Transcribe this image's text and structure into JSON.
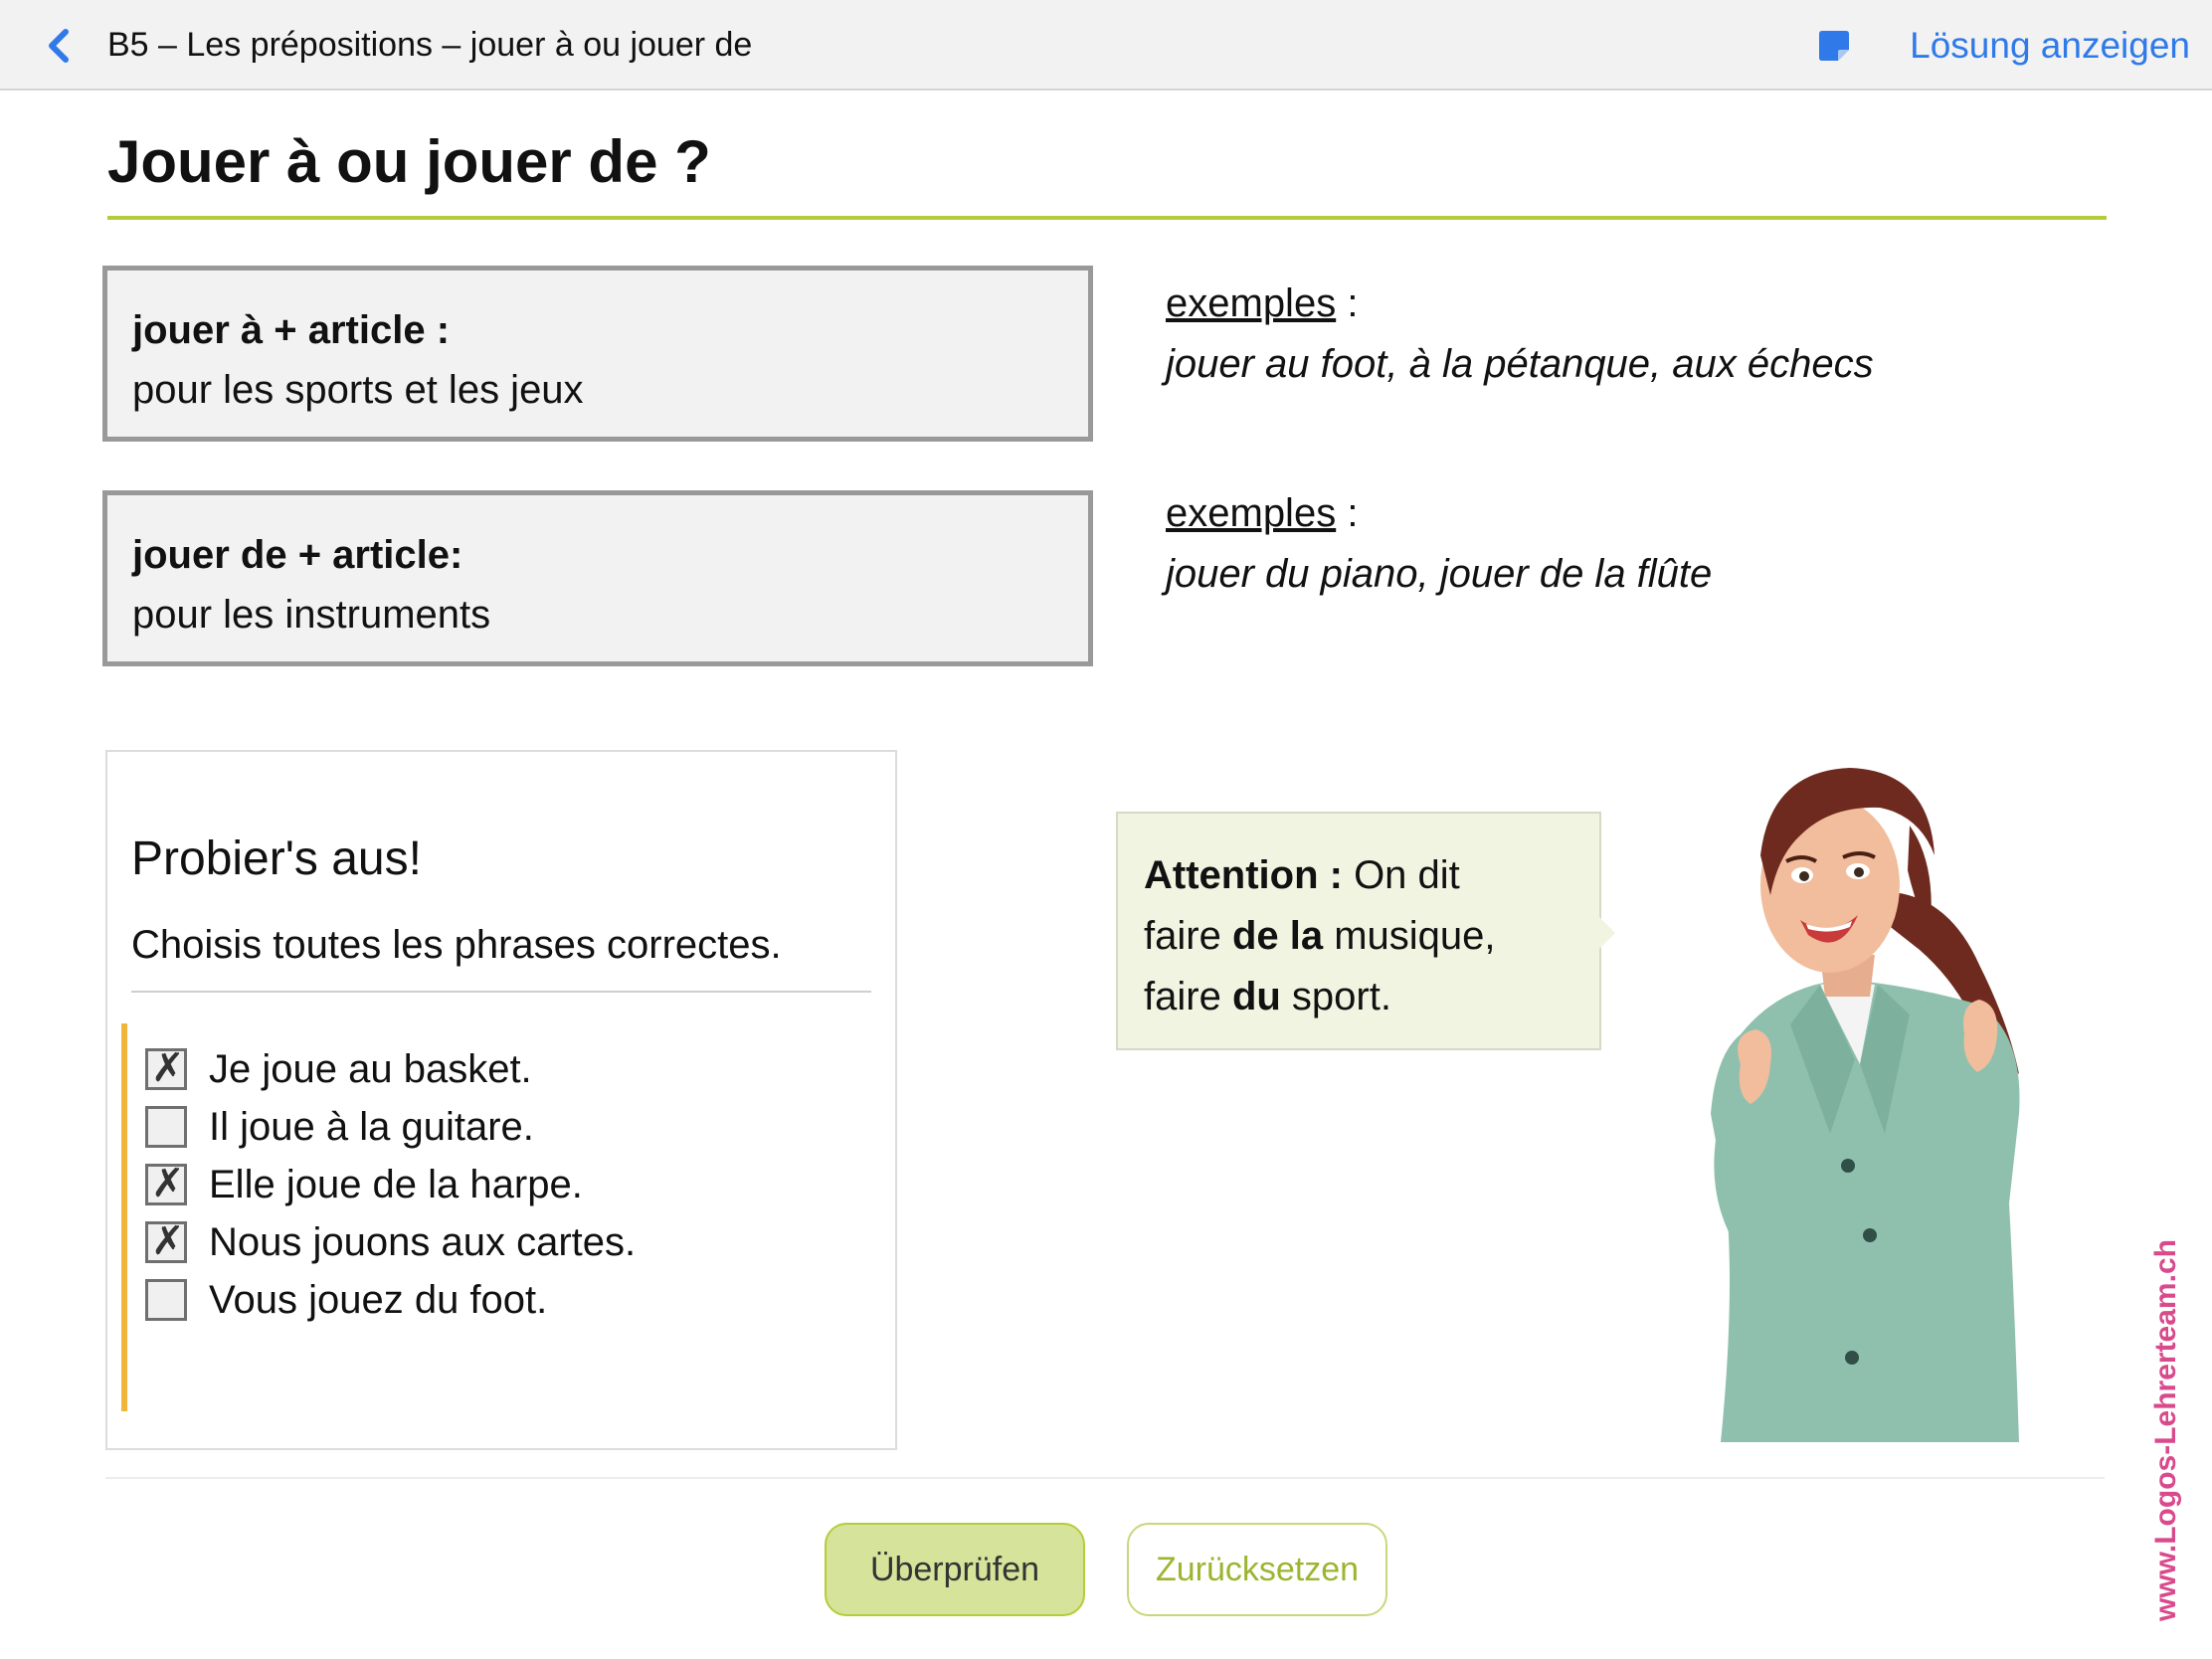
{
  "header": {
    "title": "B5 – Les prépositions – jouer à ou jouer de",
    "solution_label": "Lösung anzeigen",
    "accent_color": "#2f7ae8"
  },
  "page": {
    "title": "Jouer à ou jouer de ?",
    "title_rule_color": "#b4cc3a"
  },
  "rules": [
    {
      "head": "jouer à + article :",
      "desc": "pour les sports et les jeux",
      "example_label": "exemples",
      "example_sep": " :",
      "example_text": "jouer au foot, à la pétanque, aux échecs"
    },
    {
      "head": "jouer de + article:",
      "desc": "pour les instruments",
      "example_label": "exemples",
      "example_sep": " :",
      "example_text": "jouer du piano, jouer de la flûte"
    }
  ],
  "exercise": {
    "heading": "Probier's aus!",
    "instruction": "Choisis toutes les phrases correctes.",
    "options": [
      {
        "label": "Je joue au basket.",
        "checked": true
      },
      {
        "label": "Il joue à la guitare.",
        "checked": false
      },
      {
        "label": "Elle joue de la harpe.",
        "checked": true
      },
      {
        "label": "Nous jouons aux cartes.",
        "checked": true
      },
      {
        "label": "Vous jouez du foot.",
        "checked": false
      }
    ]
  },
  "bubble": {
    "line1_bold": "Attention :",
    "line1_rest": " On dit",
    "line2_pre": "faire ",
    "line2_bold": "de la",
    "line2_post": " musique,",
    "line3_pre": "faire ",
    "line3_bold": "du",
    "line3_post": " sport."
  },
  "watermark": "www.Logos-Lehrerteam.ch",
  "buttons": {
    "check_label": "Überprüfen",
    "reset_label": "Zurücksetzen"
  }
}
